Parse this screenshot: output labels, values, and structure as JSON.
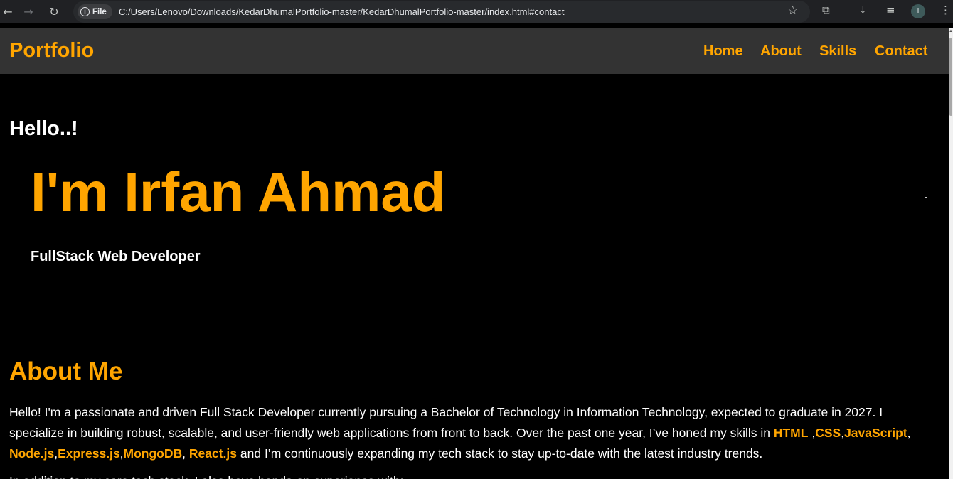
{
  "browser": {
    "chip_label": "File",
    "url": "C:/Users/Lenovo/Downloads/KedarDhumalPortfolio-master/KedarDhumalPortfolio-master/index.html#contact",
    "profile_initial": "I"
  },
  "header": {
    "brand": "Portfolio",
    "nav": {
      "home": "Home",
      "about": "About",
      "skills": "Skills",
      "contact": "Contact"
    }
  },
  "hero": {
    "greeting": "Hello..!",
    "name": "I'm Irfan Ahmad",
    "role": "FullStack Web Developer"
  },
  "about": {
    "heading": "About Me",
    "p1_a": "Hello! I'm a passionate and driven Full Stack Developer currently pursuing a Bachelor of Technology in Information Technology, expected to graduate in 2027. I specialize in building robust, scalable, and user-friendly web applications from front to back. Over the past one year, I’ve honed my skills in ",
    "skill_html": "HTML",
    "sep1": " ,",
    "skill_css": "CSS",
    "sep2": ",",
    "skill_js": "JavaScript",
    "sep3": ", ",
    "skill_node": "Node.js",
    "sep4": ",",
    "skill_express": "Express.js",
    "sep5": ",",
    "skill_mongo": "MongoDB",
    "sep6": ", ",
    "skill_react": "React.js",
    "p1_b": " and I’m continuously expanding my tech stack to stay up-to-date with the latest industry trends.",
    "p2": "In addition to my core tech stack, I also have hands-on experience with:"
  },
  "colors": {
    "accent": "#ffa500",
    "header_bg": "#333333",
    "page_bg": "#000000"
  }
}
